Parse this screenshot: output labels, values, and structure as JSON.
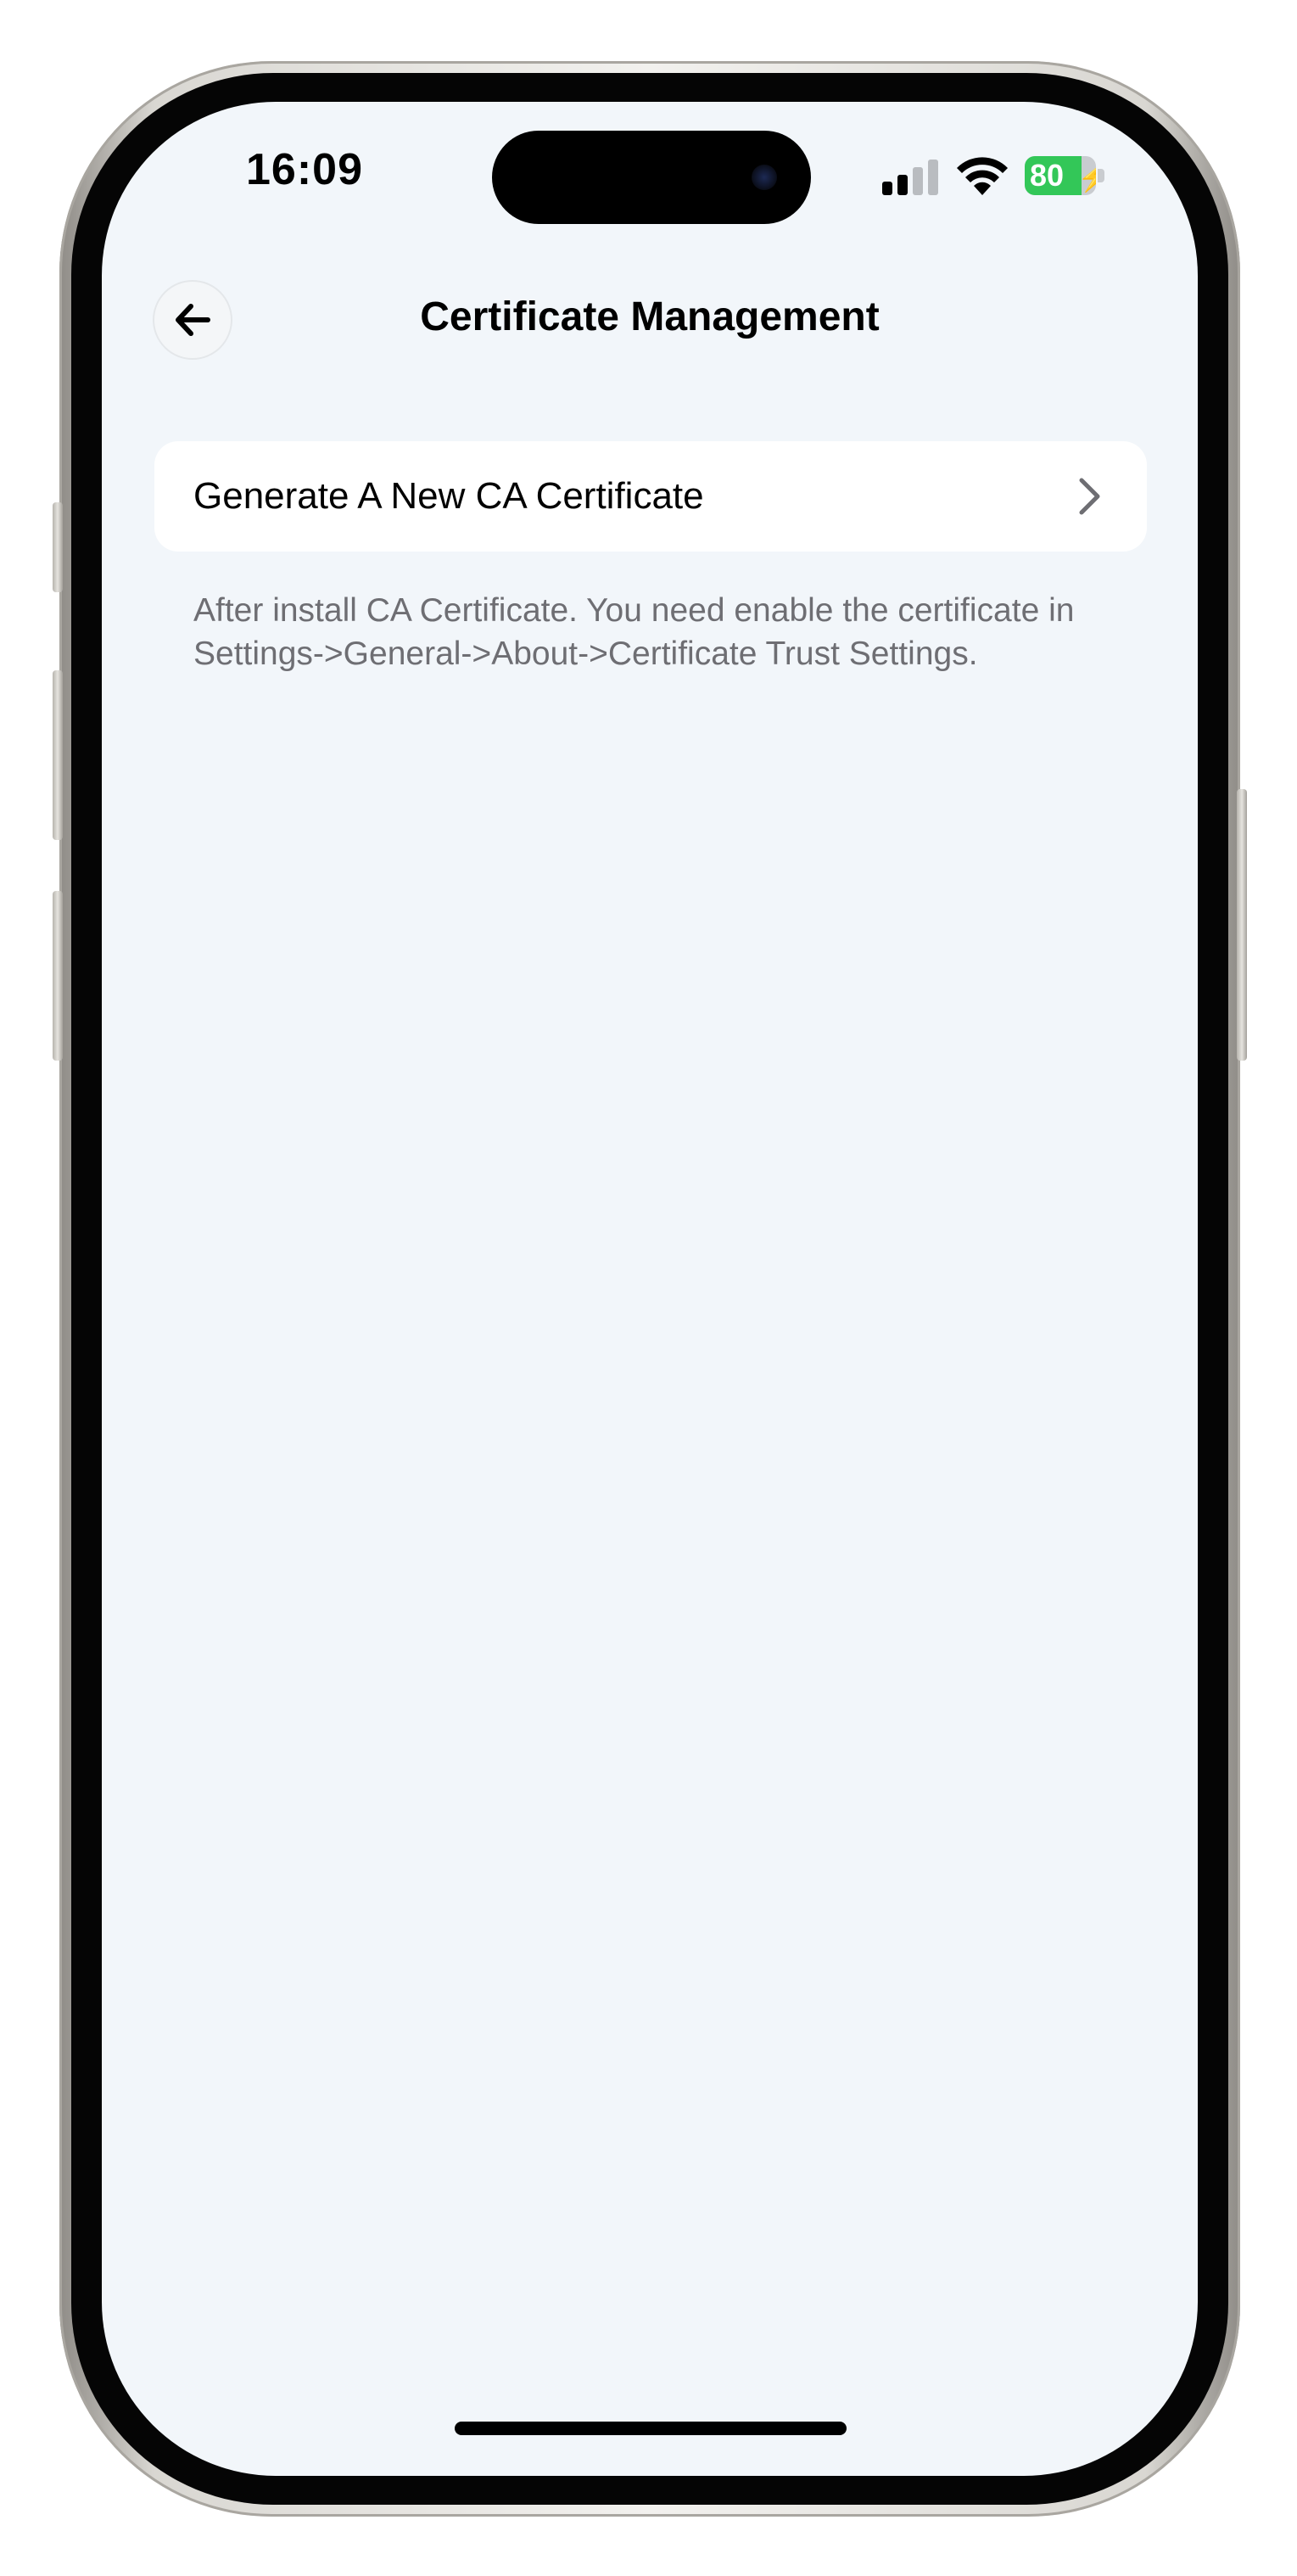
{
  "status_bar": {
    "time": "16:09",
    "signal_bars_active": 2,
    "signal_bars_total": 4,
    "wifi_icon": "wifi-icon",
    "battery_percent": "80",
    "battery_level": 0.8,
    "battery_charging": true,
    "battery_color": "#33c758"
  },
  "header": {
    "back_icon": "arrow-left-icon",
    "title": "Certificate Management"
  },
  "main": {
    "generate_item": {
      "label": "Generate A New CA Certificate",
      "icon": "chevron-right-icon"
    },
    "footnote": "After install CA Certificate. You need enable the certificate in Settings->General->About->Certificate Trust Settings."
  },
  "colors": {
    "background": "#f2f6fa",
    "card": "#ffffff",
    "footnote_text": "#6e6e73"
  }
}
